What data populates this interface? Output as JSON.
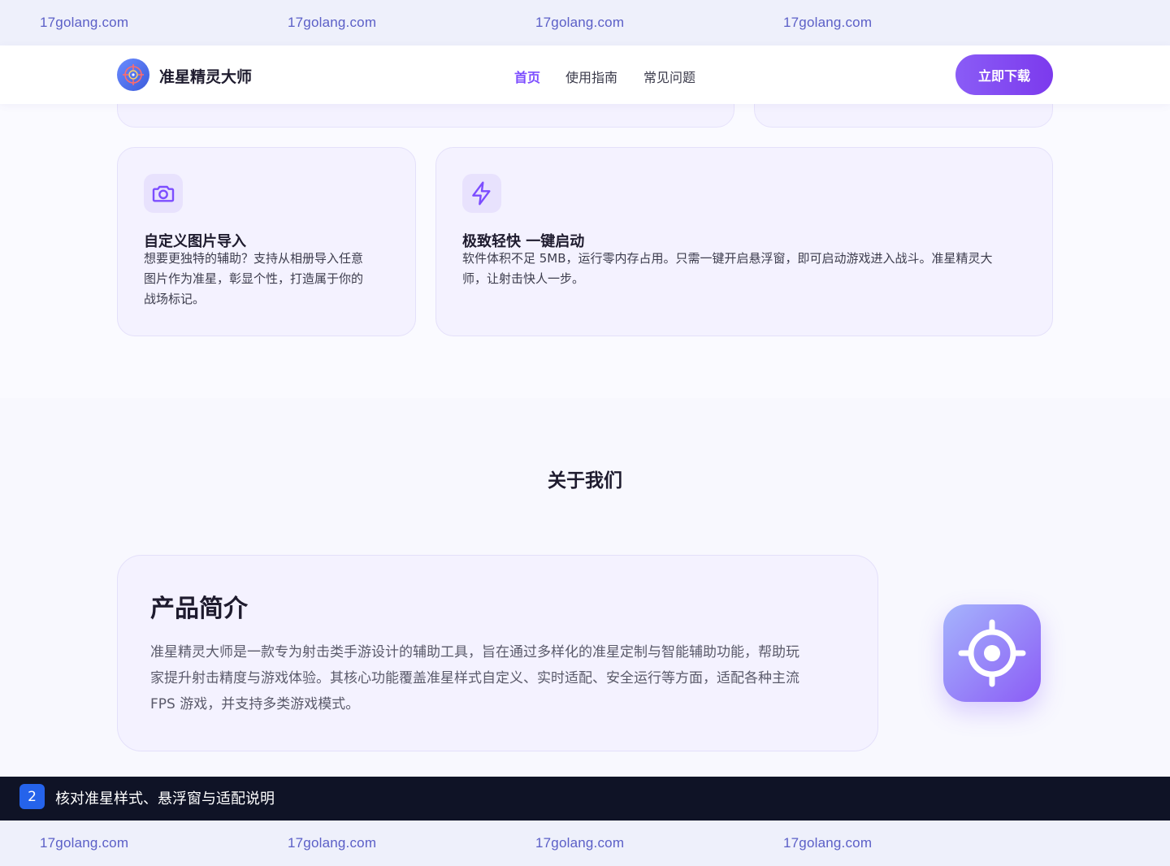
{
  "watermark": {
    "top": [
      "17golang.com",
      "17golang.com",
      "17golang.com",
      "17golang.com"
    ],
    "bottom": [
      "17golang.com",
      "17golang.com",
      "17golang.com",
      "17golang.com"
    ]
  },
  "header": {
    "brand": "准星精灵大师",
    "nav": [
      "首页",
      "使用指南",
      "常见问题"
    ],
    "active_nav": "首页",
    "cta_label": "立即下载"
  },
  "features": [
    {
      "icon": "camera-icon",
      "title": "自定义图片导入",
      "desc_lines": [
        "想要更独特的辅助？支持从相册导入任意",
        "图片作为准星，彰显个性，打造属于你的",
        "战场标记。"
      ]
    },
    {
      "icon": "lightning-icon",
      "title": "极致轻快 一键启动",
      "desc_lines": [
        "软件体积不足 5MB，运行零内存占用。只需一键开启悬浮窗，即可启动游戏进入战斗。准星精灵大",
        "师，让射击快人一步。"
      ]
    }
  ],
  "about": {
    "section_title": "关于我们",
    "card_title": "产品简介",
    "card_lines": [
      "准星精灵大师是一款专为射击类手游设计的辅助工具，旨在通过多样化的准星定制与智能辅助功能，帮助玩",
      "家提升射击精度与游戏体验。其核心功能覆盖准星样式自定义、实时适配、安全运行等方面，适配各种主流",
      "FPS 游戏，并支持多类游戏模式。"
    ],
    "app_icon": "crosshair-icon"
  },
  "step": {
    "number": "2",
    "text": "核对准星样式、悬浮窗与适配说明"
  },
  "colors": {
    "accent": "#7c4dff",
    "step_bar": "#0f1326",
    "step_badge": "#2563eb",
    "watermark_bg": "#eef0fb"
  }
}
